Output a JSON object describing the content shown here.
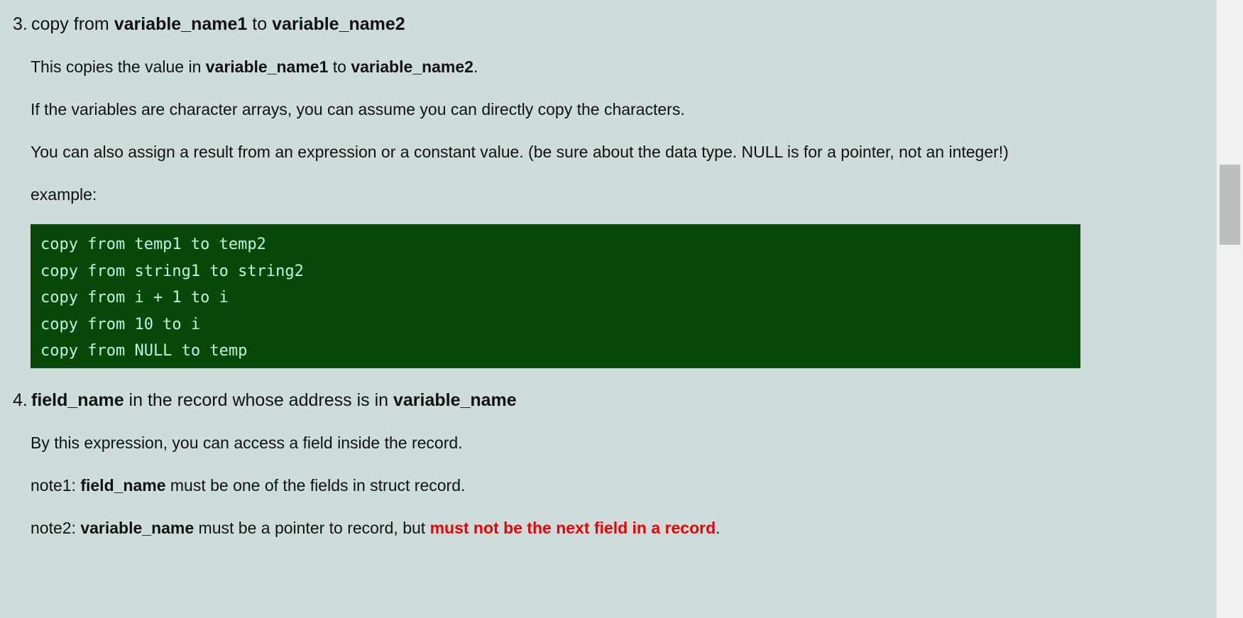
{
  "theme": {
    "page_background": "#cedddb",
    "code_background": "#084808",
    "code_text": "#bdf5e0",
    "text": "#111111",
    "warning_text": "#ee0000",
    "scrollbar_track": "#f0f0f0",
    "scrollbar_thumb": "#bdbdbd"
  },
  "sections": {
    "item3": {
      "number": "3.",
      "title_pre": "copy from ",
      "title_bold1": "variable_name1",
      "title_mid": " to ",
      "title_bold2": "variable_name2",
      "paragraphs": {
        "p1_pre": "This copies the value in ",
        "p1_bold1": "variable_name1",
        "p1_mid": " to ",
        "p1_bold2": "variable_name2",
        "p1_post": ".",
        "p2": "If the variables are character arrays, you can assume you can directly copy the characters.",
        "p3": "You can also assign a result from an expression or a constant value. (be sure about the data type. NULL is for a pointer, not an integer!)",
        "p4": "example:"
      },
      "code_lines": [
        "copy from temp1 to temp2",
        "copy from string1 to string2",
        "copy from i + 1 to i",
        "copy from 10 to i",
        "copy from NULL to temp"
      ]
    },
    "item4": {
      "number": "4.",
      "title_bold1": "field_name",
      "title_mid": " in the record whose address is in ",
      "title_bold2": "variable_name",
      "paragraphs": {
        "p1": "By this expression, you can access a field inside the record.",
        "note1_pre": "note1: ",
        "note1_bold": "field_name",
        "note1_post": " must be one of the fields in struct record.",
        "note2_pre": "note2: ",
        "note2_bold": "variable_name",
        "note2_mid": " must be a pointer to record, but ",
        "note2_red": "must not be the next field in a record",
        "note2_post": "."
      }
    }
  }
}
